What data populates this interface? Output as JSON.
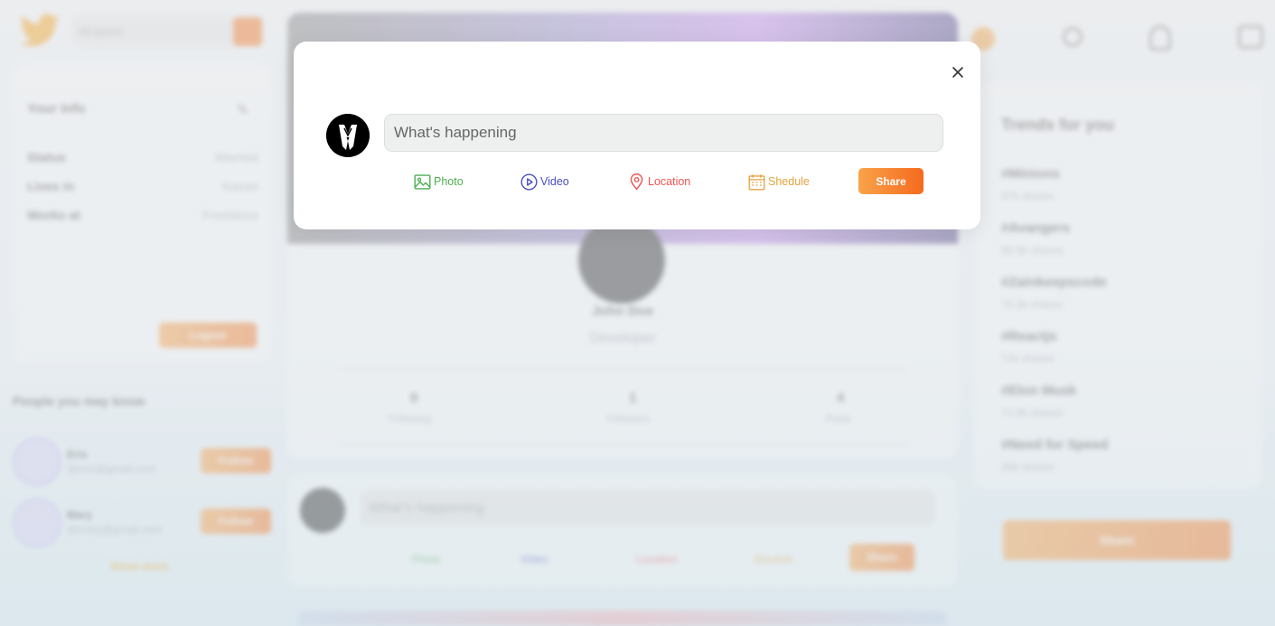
{
  "search": {
    "placeholder": "#Explore"
  },
  "info": {
    "title": "Your Info",
    "rows": [
      {
        "label": "Status",
        "value": "Married"
      },
      {
        "label": "Lives in",
        "value": "Kazan"
      },
      {
        "label": "Works at",
        "value": "Freelance"
      }
    ],
    "logout_label": "Logout"
  },
  "people": {
    "title": "People you may know",
    "items": [
      {
        "name": "Eris",
        "email": "@eris@gmail.com",
        "follow": "Follow"
      },
      {
        "name": "Mary",
        "email": "@mary@gmail.com",
        "follow": "Follow"
      }
    ],
    "show_more": "Show more"
  },
  "profile": {
    "name": "John Doe",
    "role": "Developer",
    "stats": [
      {
        "value": "0",
        "label": "Following"
      },
      {
        "value": "1",
        "label": "Followers"
      },
      {
        "value": "4",
        "label": "Posts"
      }
    ]
  },
  "post_bg": {
    "placeholder": "What's happening",
    "options": [
      "Photo",
      "Video",
      "Location",
      "Shedule"
    ],
    "share": "Share"
  },
  "trends": {
    "title": "Trends for you",
    "items": [
      {
        "tag": "#Minions",
        "shares": "97k shares"
      },
      {
        "tag": "#Avangers",
        "shares": "80.5k shares"
      },
      {
        "tag": "#Zainkeepscode",
        "shares": "75.5k shares"
      },
      {
        "tag": "#Reactjs",
        "shares": "72k shares"
      },
      {
        "tag": "#Elon Musk",
        "shares": "71.9k shares"
      },
      {
        "tag": "#Need for Speed",
        "shares": "20k shares"
      }
    ],
    "share_button": "Share"
  },
  "modal": {
    "placeholder": "What's happening",
    "photo": "Photo",
    "video": "Video",
    "location": "Location",
    "schedule": "Shedule",
    "share": "Share"
  },
  "colors": {
    "accent": "#f57c2a",
    "photo": "#4caf50",
    "video": "#4a4fc4",
    "location": "#ef5350",
    "schedule": "#e6a23c"
  }
}
